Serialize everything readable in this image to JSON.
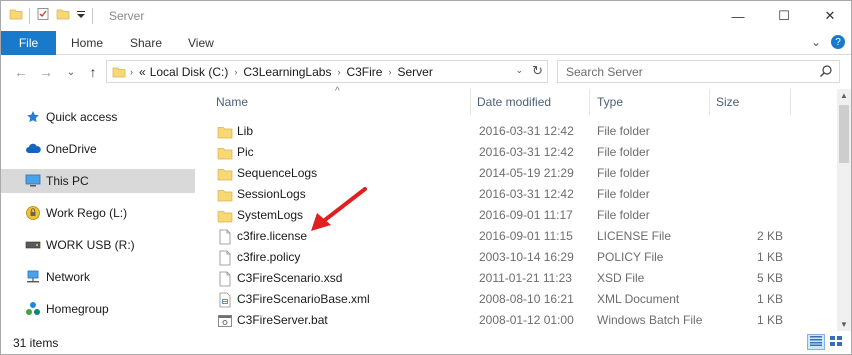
{
  "window": {
    "title": "Server",
    "minimize_glyph": "—",
    "maximize_glyph": "☐",
    "close_glyph": "✕"
  },
  "ribbon": {
    "tabs": [
      "File",
      "Home",
      "Share",
      "View"
    ],
    "expand_glyph": "⌄",
    "help_glyph": "?"
  },
  "navigation": {
    "back_glyph": "←",
    "forward_glyph": "→",
    "recent_glyph": "⌄",
    "up_glyph": "↑",
    "crumb_overflow": "«",
    "breadcrumbs": [
      "Local Disk (C:)",
      "C3LearningLabs",
      "C3Fire",
      "Server"
    ],
    "refresh_glyph": "↻",
    "search_placeholder": "Search Server"
  },
  "nav_pane": {
    "items": [
      {
        "label": "Quick access",
        "icon": "star-icon"
      },
      {
        "label": "OneDrive",
        "icon": "cloud-icon"
      },
      {
        "label": "This PC",
        "icon": "computer-icon",
        "selected": true
      },
      {
        "label": "Work Rego (L:)",
        "icon": "locked-drive-icon"
      },
      {
        "label": "WORK USB (R:)",
        "icon": "usb-drive-icon"
      },
      {
        "label": "Network",
        "icon": "network-icon"
      },
      {
        "label": "Homegroup",
        "icon": "homegroup-icon"
      }
    ]
  },
  "columns": {
    "name": "Name",
    "date": "Date modified",
    "type": "Type",
    "size": "Size",
    "sort_glyph": "^"
  },
  "files": [
    {
      "name": "Lib",
      "date": "2016-03-31 12:42",
      "type": "File folder",
      "size": "",
      "icon": "folder-icon"
    },
    {
      "name": "Pic",
      "date": "2016-03-31 12:42",
      "type": "File folder",
      "size": "",
      "icon": "folder-icon"
    },
    {
      "name": "SequenceLogs",
      "date": "2014-05-19 21:29",
      "type": "File folder",
      "size": "",
      "icon": "folder-icon"
    },
    {
      "name": "SessionLogs",
      "date": "2016-03-31 12:42",
      "type": "File folder",
      "size": "",
      "icon": "folder-icon"
    },
    {
      "name": "SystemLogs",
      "date": "2016-09-01 11:17",
      "type": "File folder",
      "size": "",
      "icon": "folder-icon"
    },
    {
      "name": "c3fire.license",
      "date": "2016-09-01 11:15",
      "type": "LICENSE File",
      "size": "2 KB",
      "icon": "document-icon"
    },
    {
      "name": "c3fire.policy",
      "date": "2003-10-14 16:29",
      "type": "POLICY File",
      "size": "1 KB",
      "icon": "document-icon"
    },
    {
      "name": "C3FireScenario.xsd",
      "date": "2011-01-21 11:23",
      "type": "XSD File",
      "size": "5 KB",
      "icon": "document-icon"
    },
    {
      "name": "C3FireScenarioBase.xml",
      "date": "2008-08-10 16:21",
      "type": "XML Document",
      "size": "1 KB",
      "icon": "xml-document-icon"
    },
    {
      "name": "C3FireServer.bat",
      "date": "2008-01-12 01:00",
      "type": "Windows Batch File",
      "size": "1 KB",
      "icon": "batch-file-icon"
    }
  ],
  "status": {
    "item_count": "31 items"
  },
  "colors": {
    "file_tab": "#1979ca",
    "folder": "#f8d775",
    "annotation_arrow": "#e02020"
  }
}
